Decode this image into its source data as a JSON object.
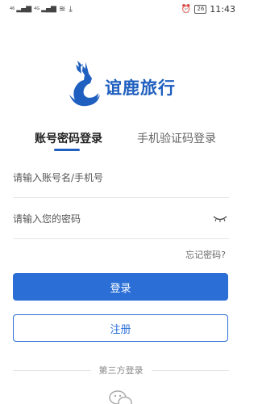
{
  "status_bar": {
    "network_badge": "46",
    "network_badge2": "4G",
    "battery": "26",
    "time": "11:43"
  },
  "app": {
    "name": "谊鹿旅行",
    "brand_color": "#1f5fbf"
  },
  "tabs": [
    {
      "label": "账号密码登录",
      "active": true
    },
    {
      "label": "手机验证码登录",
      "active": false
    }
  ],
  "form": {
    "account_placeholder": "请输入账号名/手机号",
    "password_placeholder": "请输入您的密码",
    "forgot_label": "忘记密码?"
  },
  "buttons": {
    "login_label": "登录",
    "register_label": "注册"
  },
  "third_party": {
    "label": "第三方登录",
    "icons": [
      "wechat-icon"
    ]
  }
}
